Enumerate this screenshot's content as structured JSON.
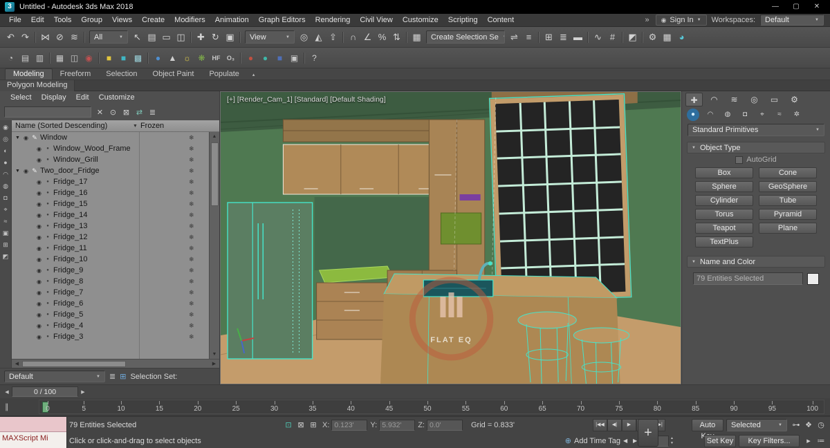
{
  "titlebar": {
    "title": "Untitled - Autodesk 3ds Max 2018",
    "logo": "3"
  },
  "icons": {
    "minimize": "—",
    "maximize": "▢",
    "close": "✕",
    "overflow": "»",
    "user": "◉",
    "dd": "▼",
    "eye": "◉",
    "snowflake": "❄",
    "filter": "▼",
    "left_arrow": "◀",
    "right_arrow": "▶",
    "up": "▲",
    "down": "▼",
    "ribbon_min": "▴",
    "curve_toggle": "∥",
    "big_key": "+",
    "time_tag": "⊕"
  },
  "menubar": {
    "items": [
      "File",
      "Edit",
      "Tools",
      "Group",
      "Views",
      "Create",
      "Modifiers",
      "Animation",
      "Graph Editors",
      "Rendering",
      "Civil View",
      "Customize",
      "Scripting",
      "Content"
    ],
    "signin": "Sign In",
    "workspaces_label": "Workspaces:",
    "workspaces_value": "Default"
  },
  "toolbar1": {
    "filter_value": "All",
    "coord_value": "View",
    "named_sets_value": "Create Selection Se",
    "seg_a": [
      {
        "name": "undo-icon",
        "glyph": "↶"
      },
      {
        "name": "redo-icon",
        "glyph": "↷"
      },
      {
        "kind": "sep",
        "name": "toolbar-separator",
        "inter": "false"
      },
      {
        "name": "select-and-link-icon",
        "glyph": "⋈"
      },
      {
        "name": "unlink-selection-icon",
        "glyph": "⊘"
      },
      {
        "name": "bind-to-space-warp-icon",
        "glyph": "≋"
      },
      {
        "kind": "sep",
        "name": "toolbar-separator",
        "inter": "false"
      }
    ],
    "seg_b": [
      {
        "name": "select-object-icon",
        "glyph": "↖"
      },
      {
        "name": "select-by-name-icon",
        "glyph": "▤"
      },
      {
        "name": "rectangular-selection-region-icon",
        "glyph": "▭"
      },
      {
        "name": "window-crossing-toggle-icon",
        "glyph": "◫"
      },
      {
        "kind": "sep",
        "name": "toolbar-separator",
        "inter": "false"
      },
      {
        "name": "select-and-move-icon",
        "glyph": "✚"
      },
      {
        "name": "select-and-rotate-icon",
        "glyph": "↻"
      },
      {
        "name": "select-and-scale-icon",
        "glyph": "▣"
      },
      {
        "kind": "sep",
        "name": "toolbar-separator",
        "inter": "false"
      }
    ],
    "seg_c": [
      {
        "name": "use-pivot-point-icon",
        "glyph": "◎"
      },
      {
        "name": "select-and-manipulate-icon",
        "glyph": "◭"
      },
      {
        "name": "keyboard-shortcut-override-icon",
        "glyph": "⇧"
      },
      {
        "kind": "sep",
        "name": "toolbar-separator",
        "inter": "false"
      },
      {
        "name": "snaps-toggle-icon",
        "glyph": "∩"
      },
      {
        "name": "angle-snap-icon",
        "glyph": "∠"
      },
      {
        "name": "percent-snap-icon",
        "glyph": "%"
      },
      {
        "name": "spinner-snap-icon",
        "glyph": "⇅"
      },
      {
        "kind": "sep",
        "name": "toolbar-separator",
        "inter": "false"
      },
      {
        "name": "edit-named-selection-sets-icon",
        "glyph": "▦"
      }
    ],
    "seg_d": [
      {
        "name": "mirror-icon",
        "glyph": "⇌"
      },
      {
        "name": "align-icon",
        "glyph": "≡"
      },
      {
        "kind": "sep",
        "name": "toolbar-separator",
        "inter": "false"
      },
      {
        "name": "toggle-scene-explorer-icon",
        "glyph": "⊞"
      },
      {
        "name": "toggle-layer-explorer-icon",
        "glyph": "≣"
      },
      {
        "name": "toggle-ribbon-icon",
        "glyph": "▬"
      },
      {
        "kind": "sep",
        "name": "toolbar-separator",
        "inter": "false"
      },
      {
        "name": "curve-editor-icon",
        "glyph": "∿"
      },
      {
        "name": "schematic-view-icon",
        "glyph": "#"
      },
      {
        "kind": "sep",
        "name": "toolbar-separator",
        "inter": "false"
      },
      {
        "name": "material-editor-icon",
        "glyph": "◩"
      },
      {
        "kind": "sep",
        "name": "toolbar-separator",
        "inter": "false"
      },
      {
        "name": "render-setup-icon",
        "glyph": "⚙"
      },
      {
        "name": "rendered-frame-window-icon",
        "glyph": "▦"
      },
      {
        "name": "render-production-icon",
        "glyph": "◕",
        "color": "#59c8d8"
      }
    ]
  },
  "toolbar2": {
    "items": [
      {
        "name": "undo-view-icon",
        "glyph": "◔",
        "color": "#c8c8c8"
      },
      {
        "name": "scene-explorer-icon",
        "glyph": "▤",
        "color": "#c8c8c8"
      },
      {
        "name": "layer-explorer-icon",
        "glyph": "▥",
        "color": "#c8c8c8"
      },
      {
        "kind": "sep",
        "name": "toolbar-separator",
        "inter": "false"
      },
      {
        "name": "state-sets-icon",
        "glyph": "▦",
        "color": "#c8c8c8"
      },
      {
        "name": "camera-sequencer-icon",
        "glyph": "◫",
        "color": "#c8c8c8"
      },
      {
        "name": "video-capture-icon",
        "glyph": "◉",
        "color": "#c05050"
      },
      {
        "kind": "sep",
        "name": "toolbar-separator",
        "inter": "false"
      },
      {
        "name": "yellow-material-icon",
        "glyph": "■",
        "color": "#e2c63e"
      },
      {
        "name": "teal-material-icon",
        "glyph": "■",
        "color": "#3fb6c4"
      },
      {
        "name": "checker-material-icon",
        "glyph": "▩",
        "color": "#9ad0d8"
      },
      {
        "kind": "sep",
        "name": "toolbar-separator",
        "inter": "false"
      },
      {
        "name": "water-drop-icon",
        "glyph": "●",
        "color": "#4f8fd0"
      },
      {
        "name": "cone-helper-icon",
        "glyph": "▲",
        "color": "#d0d0d0"
      },
      {
        "name": "sun-light-icon",
        "glyph": "☼",
        "color": "#e8d44a"
      },
      {
        "name": "foliage-icon",
        "glyph": "❋",
        "color": "#7fae4a"
      },
      {
        "name": "hf-utility-icon",
        "glyph": "HF",
        "color": "#c8c8c8",
        "kind": "txt-ico"
      },
      {
        "name": "ozone-icon",
        "glyph": "O₃",
        "color": "#c8c8c8",
        "kind": "txt-ico"
      },
      {
        "kind": "sep",
        "name": "toolbar-separator",
        "inter": "false"
      },
      {
        "name": "red-sphere-icon",
        "glyph": "●",
        "color": "#c05040"
      },
      {
        "name": "teal-sphere-icon",
        "glyph": "●",
        "color": "#3fb8a8"
      },
      {
        "name": "blue-cube-icon",
        "glyph": "■",
        "color": "#4f6fb8"
      },
      {
        "name": "container-icon",
        "glyph": "▣",
        "color": "#c8c8c8"
      },
      {
        "kind": "sep",
        "name": "toolbar-separator",
        "inter": "false"
      },
      {
        "name": "help-icon",
        "glyph": "?",
        "color": "#cfcfcf"
      }
    ]
  },
  "ribbon": {
    "tabs": [
      {
        "label": "Modeling",
        "kind": "active"
      },
      {
        "label": "Freeform"
      },
      {
        "label": "Selection"
      },
      {
        "label": "Object Paint"
      },
      {
        "label": "Populate"
      }
    ],
    "subtab": "Polygon Modeling"
  },
  "explorer": {
    "menu": [
      "Select",
      "Display",
      "Edit",
      "Customize"
    ],
    "search_value": "",
    "toolbar_icons": [
      {
        "name": "clear-search-icon",
        "glyph": "✕",
        "color": "#cfcfcf"
      },
      {
        "name": "pick-object-icon",
        "glyph": "⊙",
        "color": "#cfcfcf"
      },
      {
        "name": "lock-explorer-icon",
        "glyph": "⊠",
        "color": "#cfcfcf"
      },
      {
        "name": "sync-selection-icon",
        "glyph": "⇄",
        "color": "#7fc8b8"
      },
      {
        "name": "column-chooser-icon",
        "glyph": "≣",
        "color": "#cfcfcf"
      }
    ],
    "header_name": "Name (Sorted Descending)",
    "header_frozen": "Frozen",
    "side_icons": [
      {
        "name": "show-all-icon",
        "glyph": "◉"
      },
      {
        "name": "show-none-icon",
        "glyph": "◎"
      },
      {
        "name": "show-inverted-icon",
        "glyph": "◐"
      },
      {
        "name": "show-geometry-icon",
        "glyph": "●"
      },
      {
        "name": "show-shapes-icon",
        "glyph": "◠"
      },
      {
        "name": "show-lights-icon",
        "glyph": "◍"
      },
      {
        "name": "show-cameras-icon",
        "glyph": "◘"
      },
      {
        "name": "show-helpers-icon",
        "glyph": "⌖"
      },
      {
        "name": "show-spacewarps-icon",
        "glyph": "≈"
      },
      {
        "name": "show-groups-icon",
        "glyph": "▣"
      },
      {
        "name": "show-xrefs-icon",
        "glyph": "⊞"
      },
      {
        "name": "show-materials-icon",
        "glyph": "◩"
      }
    ],
    "items": [
      {
        "type": "parent",
        "arrow": "▼",
        "oicon": "✎",
        "label": "Window"
      },
      {
        "type": "child",
        "oicon": "●",
        "label": "Window_Wood_Frame"
      },
      {
        "type": "child",
        "oicon": "●",
        "label": "Window_Grill"
      },
      {
        "type": "parent",
        "arrow": "▼",
        "oicon": "✎",
        "label": "Two_door_Fridge"
      },
      {
        "type": "child",
        "oicon": "●",
        "label": "Fridge_17"
      },
      {
        "type": "child",
        "oicon": "●",
        "label": "Fridge_16"
      },
      {
        "type": "child",
        "oicon": "●",
        "label": "Fridge_15"
      },
      {
        "type": "child",
        "oicon": "●",
        "label": "Fridge_14"
      },
      {
        "type": "child",
        "oicon": "●",
        "label": "Fridge_13"
      },
      {
        "type": "child",
        "oicon": "●",
        "label": "Fridge_12"
      },
      {
        "type": "child",
        "oicon": "●",
        "label": "Fridge_11"
      },
      {
        "type": "child",
        "oicon": "●",
        "label": "Fridge_10"
      },
      {
        "type": "child",
        "oicon": "●",
        "label": "Fridge_9"
      },
      {
        "type": "child",
        "oicon": "●",
        "label": "Fridge_8"
      },
      {
        "type": "child",
        "oicon": "●",
        "label": "Fridge_7"
      },
      {
        "type": "child",
        "oicon": "●",
        "label": "Fridge_6"
      },
      {
        "type": "child",
        "oicon": "●",
        "label": "Fridge_5"
      },
      {
        "type": "child",
        "oicon": "●",
        "label": "Fridge_4"
      },
      {
        "type": "child",
        "oicon": "●",
        "label": "Fridge_3"
      }
    ],
    "footer_value": "Default",
    "footer_label": "Selection Set:"
  },
  "viewport": {
    "label": "[+] [Render_Cam_1] [Standard] [Default Shading]",
    "watermark": "FLAT EQ"
  },
  "command_panel": {
    "tabs": [
      {
        "name": "create-tab-icon",
        "glyph": "✚",
        "kind": "active"
      },
      {
        "name": "modify-tab-icon",
        "glyph": "◠"
      },
      {
        "name": "hierarchy-tab-icon",
        "glyph": "≋"
      },
      {
        "name": "motion-tab-icon",
        "glyph": "◎"
      },
      {
        "name": "display-tab-icon",
        "glyph": "▭"
      },
      {
        "name": "utilities-tab-icon",
        "glyph": "⚙"
      }
    ],
    "categories": [
      {
        "name": "geometry-category-icon",
        "glyph": "●",
        "kind": "active"
      },
      {
        "name": "shapes-category-icon",
        "glyph": "◠"
      },
      {
        "name": "lights-category-icon",
        "glyph": "◍"
      },
      {
        "name": "cameras-category-icon",
        "glyph": "◘"
      },
      {
        "name": "helpers-category-icon",
        "glyph": "⌖"
      },
      {
        "name": "spacewarps-category-icon",
        "glyph": "≈"
      },
      {
        "name": "systems-category-icon",
        "glyph": "✲"
      }
    ],
    "primitive_dropdown": "Standard Primitives",
    "object_type_title": "Object Type",
    "autogrid_label": "AutoGrid",
    "object_buttons": [
      "Box",
      "Cone",
      "Sphere",
      "GeoSphere",
      "Cylinder",
      "Tube",
      "Torus",
      "Pyramid",
      "Teapot",
      "Plane",
      "TextPlus"
    ],
    "name_color_title": "Name and Color",
    "name_value": "79 Entities Selected"
  },
  "trackbar": {
    "indicator": "0 / 100"
  },
  "timeline": {
    "ticks": [
      "0",
      "5",
      "10",
      "15",
      "20",
      "25",
      "30",
      "35",
      "40",
      "45",
      "50",
      "55",
      "60",
      "65",
      "70",
      "75",
      "80",
      "85",
      "90",
      "95",
      "100"
    ]
  },
  "statusbar": {
    "maxscript_label": "MAXScript Mi",
    "selection_status": "79 Entities Selected",
    "prompt": "Click or click-and-drag to select objects",
    "row1_icons": [
      {
        "name": "isolate-selection-icon",
        "glyph": "⊡",
        "color": "#4fc8b4"
      },
      {
        "name": "selection-lock-icon",
        "glyph": "⊠",
        "color": "#cccccc"
      },
      {
        "name": "absolute-offset-toggle-icon",
        "glyph": "⊞",
        "color": "#cccccc"
      }
    ],
    "x_label": "X:",
    "x_value": "0.123'",
    "y_label": "Y:",
    "y_value": "5.932'",
    "z_label": "Z:",
    "z_value": "0.0'",
    "grid_label": "Grid = 0.833'",
    "playback": [
      {
        "name": "go-to-start-icon",
        "glyph": "|◀◀"
      },
      {
        "name": "previous-frame-icon",
        "glyph": "◀|"
      },
      {
        "name": "play-animation-icon",
        "glyph": "▶"
      },
      {
        "name": "next-frame-icon",
        "glyph": "|▶"
      },
      {
        "name": "go-to-end-icon",
        "glyph": "▶▶|"
      }
    ],
    "auto_key": "Auto Key",
    "set_key": "Set Key",
    "selected_dropdown": "Selected",
    "key_filters": "Key Filters...",
    "add_time_tag": "Add Time Tag",
    "frame_value": "0",
    "right1_icons": [
      {
        "name": "default-tangents-icon",
        "glyph": "⊶",
        "color": "#cccccc"
      },
      {
        "name": "key-tangents-icon",
        "glyph": "❖",
        "color": "#cccccc"
      },
      {
        "name": "time-configuration-icon",
        "glyph": "◷",
        "color": "#cccccc"
      }
    ],
    "right2_icons": [
      {
        "name": "mini-track-view-icon",
        "glyph": "▸",
        "color": "#cccccc"
      },
      {
        "name": "spinner-precision-icon",
        "glyph": "≔",
        "color": "#cccccc"
      }
    ]
  }
}
